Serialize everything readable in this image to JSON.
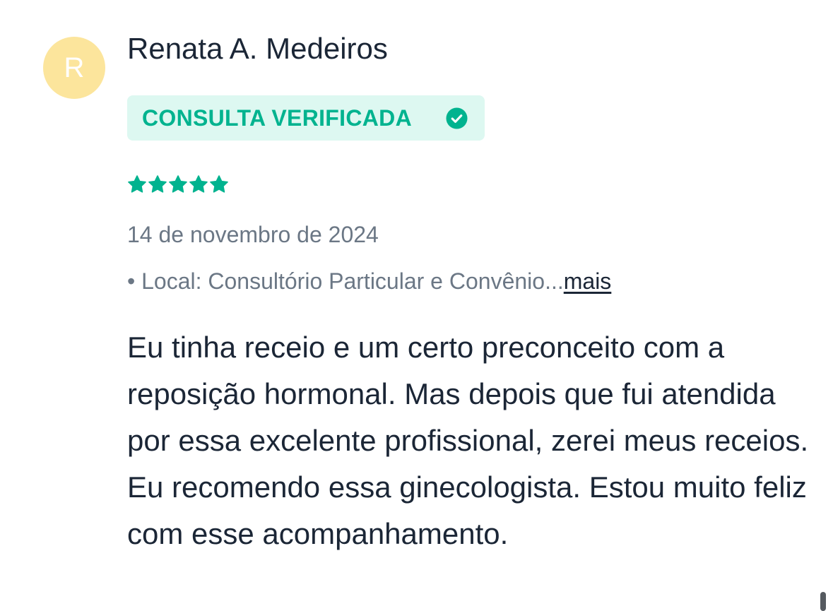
{
  "review": {
    "avatar_initial": "R",
    "author_name": "Renata A. Medeiros",
    "badge": {
      "label": "CONSULTA VERIFICADA",
      "icon": "check-circle-icon"
    },
    "rating": {
      "value": 5,
      "max": 5,
      "icon": "star-icon"
    },
    "date": "14 de novembro de 2024",
    "location": {
      "prefix": "• ",
      "text": "Local: Consultório Particular e Convênio...",
      "more_label": "mais"
    },
    "text": "Eu tinha receio e um certo preconceito com a reposição hormonal. Mas depois que fui atendida por essa excelente profissional, zerei meus receios. Eu recomendo essa ginecologista. Estou muito feliz com esse acompanhamento."
  },
  "colors": {
    "accent": "#00b38f",
    "badge_bg": "#ddf8f1",
    "avatar_bg": "#fce59c",
    "text_primary": "#1b2636",
    "text_secondary": "#6b7785"
  }
}
